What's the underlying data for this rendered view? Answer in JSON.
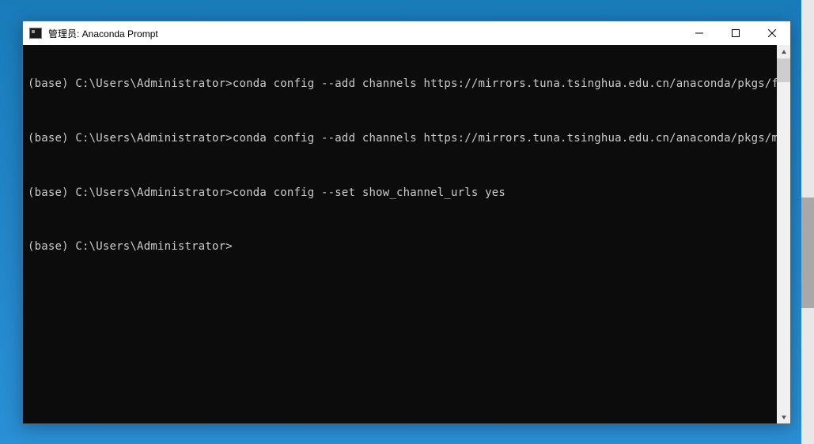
{
  "window": {
    "title": "管理员: Anaconda Prompt"
  },
  "terminal": {
    "lines": [
      {
        "prompt": "(base) C:\\Users\\Administrator>",
        "command": "conda config --add channels https://mirrors.tuna.tsinghua.edu.cn/anaconda/pkgs/free/"
      },
      {
        "prompt": "(base) C:\\Users\\Administrator>",
        "command": "conda config --add channels https://mirrors.tuna.tsinghua.edu.cn/anaconda/pkgs/main/"
      },
      {
        "prompt": "(base) C:\\Users\\Administrator>",
        "command": "conda config --set show_channel_urls yes"
      },
      {
        "prompt": "(base) C:\\Users\\Administrator>",
        "command": ""
      }
    ]
  }
}
